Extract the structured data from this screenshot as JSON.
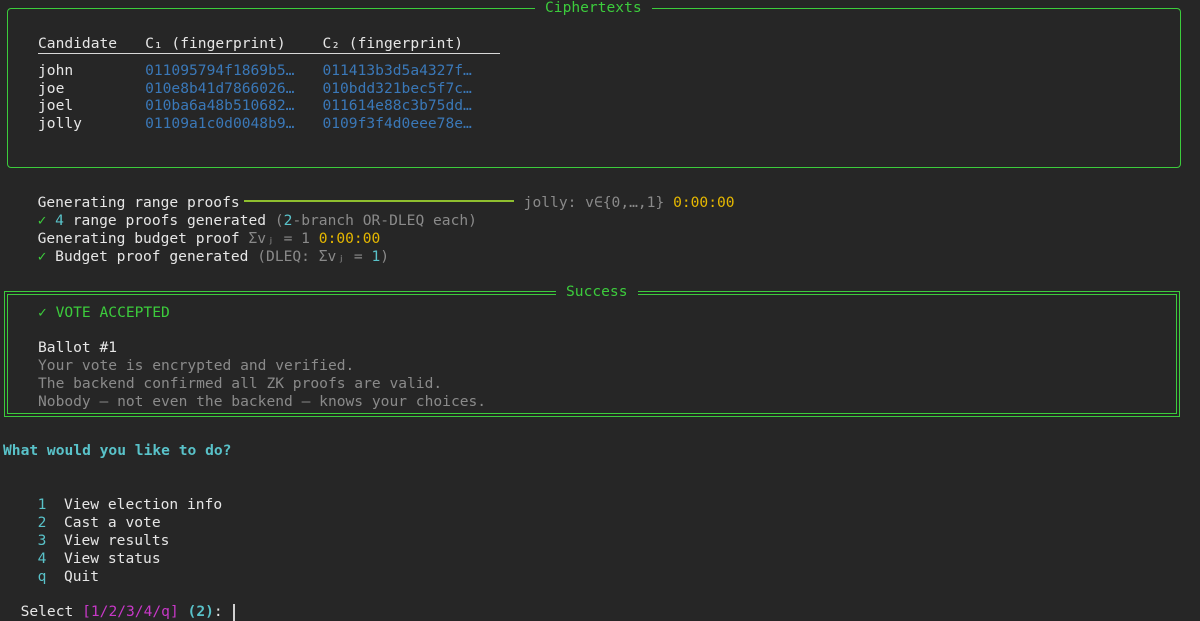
{
  "ciphertexts": {
    "title": "Ciphertexts",
    "headers": [
      "Candidate",
      "C₁ (fingerprint)",
      "C₂ (fingerprint)"
    ],
    "rows": [
      {
        "candidate": "john",
        "c1": "011095794f1869b5…",
        "c2": "011413b3d5a4327f…"
      },
      {
        "candidate": "joe",
        "c1": "010e8b41d7866026…",
        "c2": "010bdd321bec5f7c…"
      },
      {
        "candidate": "joel",
        "c1": "010ba6a48b510682…",
        "c2": "011614e88c3b75dd…"
      },
      {
        "candidate": "jolly",
        "c1": "01109a1c0d0048b9…",
        "c2": "0109f3f4d0eee78e…"
      }
    ]
  },
  "progress": {
    "range_label": "Generating range proofs",
    "range_detail": "jolly: v∈{0,…,1}",
    "range_time": "0:00:00",
    "range_done_check": "✓",
    "range_done_count": "4",
    "range_done_text": " range proofs generated ",
    "range_done_paren_open": "(",
    "range_done_branch_num": "2",
    "range_done_detail": "-branch OR-DLEQ each",
    "range_done_paren_close": ")",
    "budget_label": "Generating budget proof",
    "budget_sum": "Σvⱼ = 1",
    "budget_time": "0:00:00",
    "budget_done_check": "✓",
    "budget_done_text": " Budget proof generated ",
    "budget_done_detail_a": "(DLEQ: Σvⱼ = ",
    "budget_done_one": "1",
    "budget_done_detail_b": ")"
  },
  "success": {
    "title": "Success",
    "heading": "✓ VOTE ACCEPTED",
    "ballot": "Ballot #1",
    "lines": [
      "Your vote is encrypted and verified.",
      "The backend confirmed all ZK proofs are valid.",
      "Nobody — not even the backend — knows your choices."
    ]
  },
  "menu": {
    "prompt": "What would you like to do?",
    "options": [
      {
        "key": "1",
        "label": "View election info"
      },
      {
        "key": "2",
        "label": "Cast a vote"
      },
      {
        "key": "3",
        "label": "View results"
      },
      {
        "key": "4",
        "label": "View status"
      },
      {
        "key": "q",
        "label": "Quit"
      }
    ],
    "select_label": "Select ",
    "select_choices": "[1/2/3/4/q]",
    "select_default": "(2)",
    "select_suffix": ": "
  },
  "colors": {
    "accent_green": "#3ccc3c",
    "hex_blue": "#3a78b8",
    "teal": "#59c2c9",
    "yellow": "#e6b800",
    "magenta": "#c838c8",
    "background": "#262626"
  }
}
